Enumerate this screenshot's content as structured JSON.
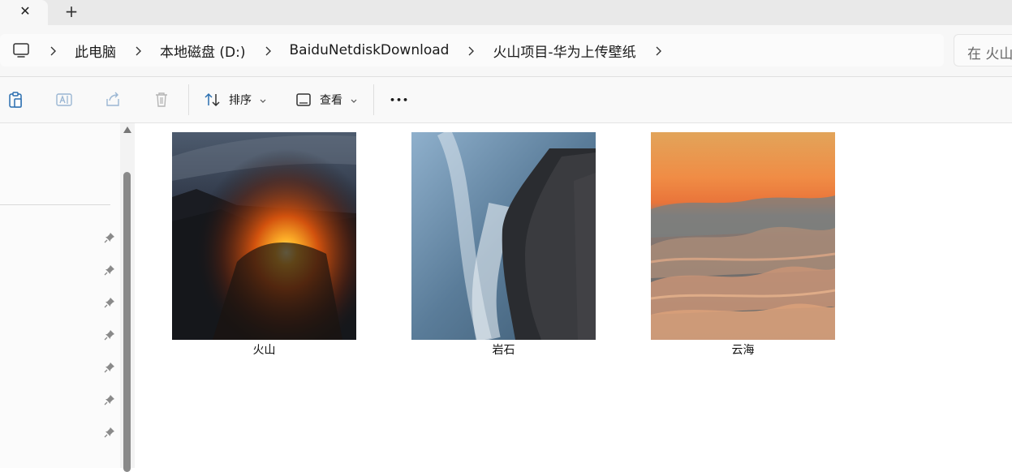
{
  "tabs": {
    "close_symbol": "✕",
    "new_symbol": "+"
  },
  "address": {
    "crumbs": [
      "此电脑",
      "本地磁盘 (D:)",
      "BaiduNetdiskDownload",
      "火山项目-华为上传壁纸"
    ],
    "search_placeholder": "在 火山"
  },
  "toolbar": {
    "sort_label": "排序",
    "view_label": "查看",
    "more_symbol": "•••"
  },
  "files": [
    {
      "name": "火山",
      "kind": "volcano"
    },
    {
      "name": "岩石",
      "kind": "rocks"
    },
    {
      "name": "云海",
      "kind": "clouds"
    }
  ],
  "colors": {
    "accent": "#2b6fb0",
    "chrome": "#e9e9e9",
    "toolbar_bg": "#f9f9f9"
  }
}
